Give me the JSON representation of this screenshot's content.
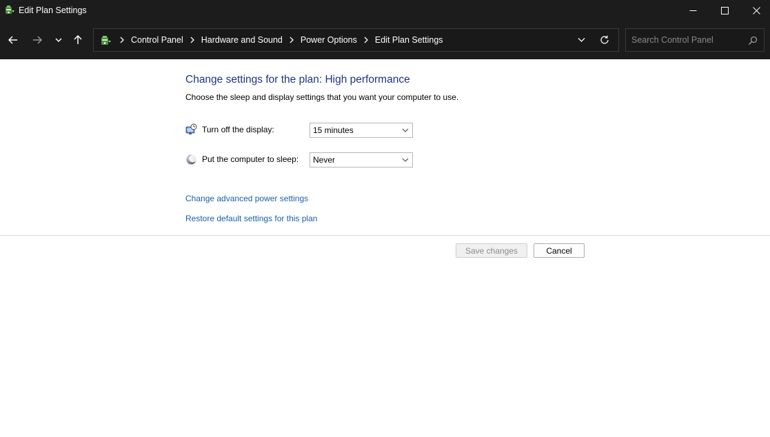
{
  "window": {
    "title": "Edit Plan Settings",
    "app_icon": "power-options-icon"
  },
  "navigation": {
    "back_icon": "arrow-left-icon",
    "forward_icon": "arrow-right-icon",
    "recent_icon": "chevron-down-icon",
    "up_icon": "arrow-up-icon",
    "breadcrumbs": [
      "Control Panel",
      "Hardware and Sound",
      "Power Options",
      "Edit Plan Settings"
    ],
    "search_placeholder": "Search Control Panel"
  },
  "main": {
    "heading": "Change settings for the plan: High performance",
    "subtext": "Choose the sleep and display settings that you want your computer to use.",
    "settings": [
      {
        "label": "Turn off the display:",
        "value": "15 minutes",
        "icon": "monitor-clock-icon"
      },
      {
        "label": "Put the computer to sleep:",
        "value": "Never",
        "icon": "moon-icon"
      }
    ],
    "links": [
      "Change advanced power settings",
      "Restore default settings for this plan"
    ],
    "buttons": {
      "save": "Save changes",
      "cancel": "Cancel"
    }
  },
  "colors": {
    "chrome_background": "#1c1c1c",
    "heading": "#1e3287",
    "link": "#1a5fa8"
  }
}
